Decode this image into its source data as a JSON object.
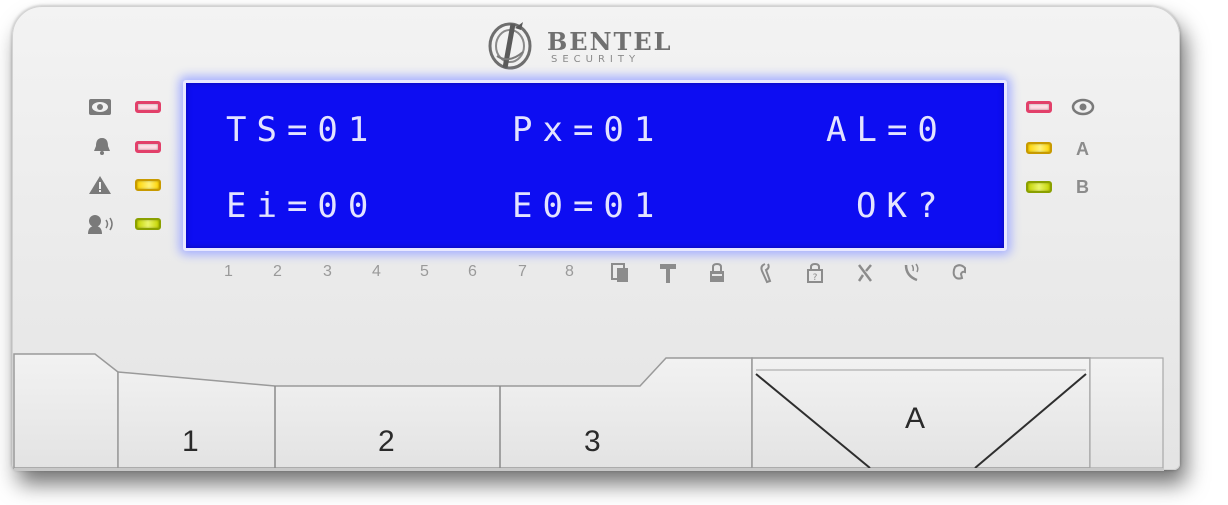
{
  "brand": {
    "name": "BENTEL",
    "subtitle": "SECURITY"
  },
  "lcd": {
    "line1": [
      "TS=01",
      "Px=01",
      "AL=0"
    ],
    "line2": [
      "Ei=00",
      "E0=01",
      "OK?"
    ],
    "background_color": "#0d0df2",
    "text_color": "#e3e3ff"
  },
  "left_indicators": [
    {
      "icon": "eye-icon",
      "led": "red"
    },
    {
      "icon": "bell-icon",
      "led": "red"
    },
    {
      "icon": "warning-icon",
      "led": "yellow"
    },
    {
      "icon": "voice-icon",
      "led": "green"
    }
  ],
  "right_indicators": [
    {
      "icon": "eye-icon",
      "led": "red",
      "label": ""
    },
    {
      "icon": "",
      "led": "yellow",
      "label": "A"
    },
    {
      "icon": "",
      "led": "green",
      "label": "B"
    }
  ],
  "zones": [
    "1",
    "2",
    "3",
    "4",
    "5",
    "6",
    "7",
    "8"
  ],
  "function_icons": [
    "copy-icon",
    "hammer-icon",
    "lock-icon",
    "wrench-icon",
    "help-lock-icon",
    "tools-icon",
    "phone-icon",
    "handset-icon"
  ],
  "keys": [
    {
      "label": "1"
    },
    {
      "label": "2"
    },
    {
      "label": "3"
    },
    {
      "label": "A"
    }
  ],
  "led_colors": {
    "red": "#e2406a",
    "yellow": "#ffd400",
    "green": "#c4d400"
  }
}
